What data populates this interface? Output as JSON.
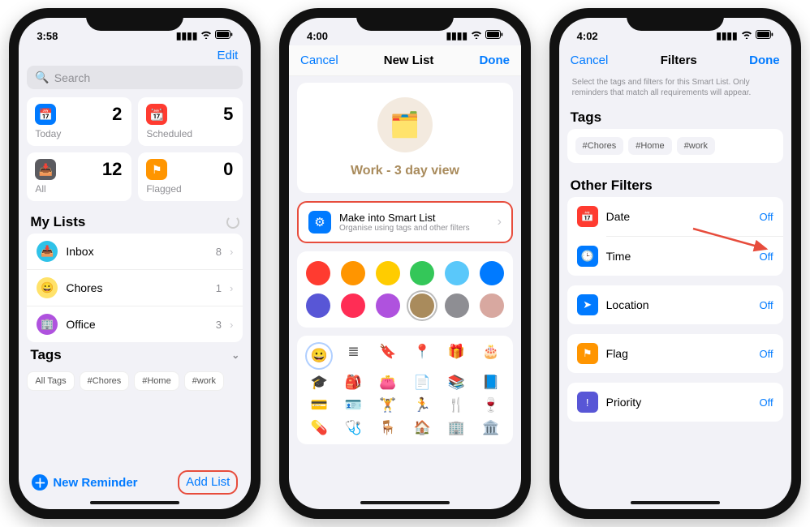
{
  "phone1": {
    "time": "3:58",
    "edit": "Edit",
    "search_placeholder": "Search",
    "cards": {
      "today": {
        "label": "Today",
        "count": "2",
        "color": "#007aff",
        "glyph": "📅"
      },
      "scheduled": {
        "label": "Scheduled",
        "count": "5",
        "color": "#ff3b30",
        "glyph": "📆"
      },
      "all": {
        "label": "All",
        "count": "12",
        "color": "#5b5b60",
        "glyph": "📥"
      },
      "flagged": {
        "label": "Flagged",
        "count": "0",
        "color": "#ff9500",
        "glyph": "⚑"
      }
    },
    "my_lists_header": "My Lists",
    "lists": [
      {
        "name": "Inbox",
        "count": "8",
        "color": "#2fc2e8",
        "glyph": "📥"
      },
      {
        "name": "Chores",
        "count": "1",
        "color": "#ffe26a",
        "glyph": "😀"
      },
      {
        "name": "Office",
        "count": "3",
        "color": "#af52de",
        "glyph": "🏢"
      }
    ],
    "tags_header": "Tags",
    "tags": [
      "All Tags",
      "#Chores",
      "#Home",
      "#work"
    ],
    "new_reminder": "New Reminder",
    "add_list": "Add List"
  },
  "phone2": {
    "time": "4:00",
    "cancel": "Cancel",
    "title": "New List",
    "done": "Done",
    "list_name": "Work - 3 day view",
    "smart_title": "Make into Smart List",
    "smart_sub": "Organise using tags and other filters",
    "colors": [
      "#ff3b30",
      "#ff9500",
      "#ffcc00",
      "#34c759",
      "#5ac8fa",
      "#007aff",
      "#5856d6",
      "#ff2d55",
      "#af52de",
      "#a98b5c",
      "#8e8e93",
      "#d8a8a0"
    ],
    "selected_color_index": 9,
    "icons": [
      "😀",
      "≣",
      "🔖",
      "📍",
      "🎁",
      "🎂",
      "🎓",
      "🎒",
      "👛",
      "📄",
      "📚",
      "📘",
      "💳",
      "🪪",
      "🏋️",
      "🏃",
      "🍴",
      "🍷",
      "💊",
      "🩺",
      "🪑",
      "🏠",
      "🏢",
      "🏛️"
    ],
    "selected_icon_index": 0
  },
  "phone3": {
    "time": "4:02",
    "cancel": "Cancel",
    "title": "Filters",
    "done": "Done",
    "hint": "Select the tags and filters for this Smart List. Only reminders that match all requirements will appear.",
    "tags_header": "Tags",
    "tags": [
      "#Chores",
      "#Home",
      "#work"
    ],
    "other_filters_header": "Other Filters",
    "filters": [
      {
        "name": "Date",
        "value": "Off",
        "color": "#ff3b30",
        "glyph": "📅"
      },
      {
        "name": "Time",
        "value": "Off",
        "color": "#007aff",
        "glyph": "🕒"
      },
      {
        "name": "Location",
        "value": "Off",
        "color": "#007aff",
        "glyph": "➤"
      },
      {
        "name": "Flag",
        "value": "Off",
        "color": "#ff9500",
        "glyph": "⚑"
      },
      {
        "name": "Priority",
        "value": "Off",
        "color": "#5856d6",
        "glyph": "!"
      }
    ]
  }
}
